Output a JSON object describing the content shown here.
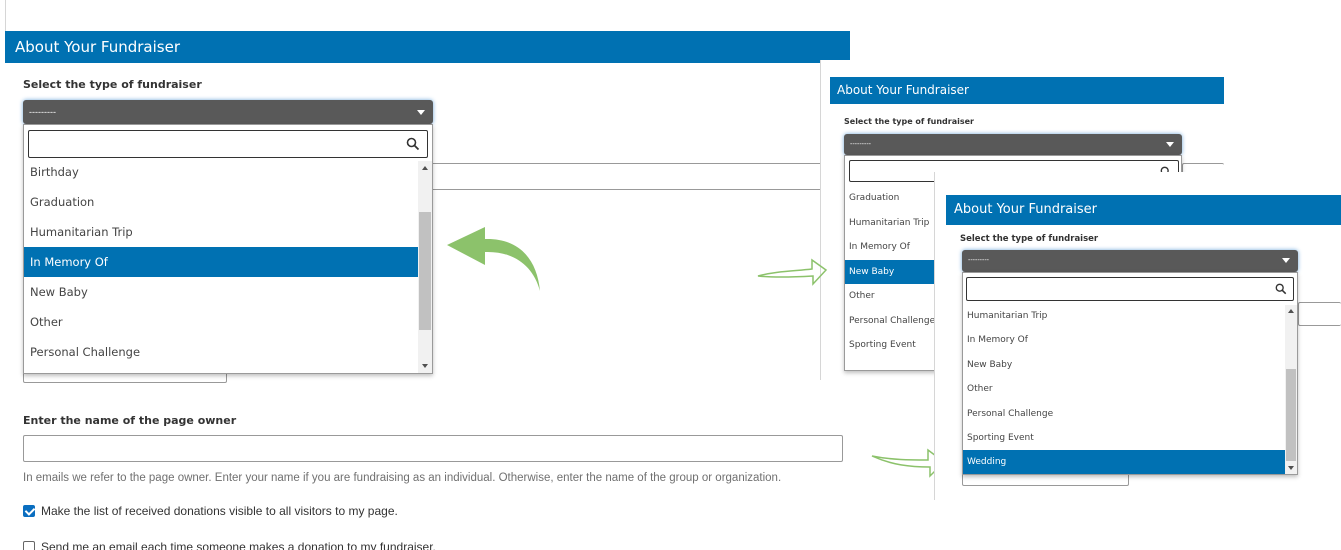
{
  "panels": {
    "main": {
      "header": "About Your Fundraiser",
      "type_label": "Select the type of fundraiser",
      "select_value": "---------",
      "search_value": "",
      "options": [
        {
          "label": "Birthday",
          "selected": false
        },
        {
          "label": "Graduation",
          "selected": false
        },
        {
          "label": "Humanitarian Trip",
          "selected": false
        },
        {
          "label": "In Memory Of",
          "selected": true
        },
        {
          "label": "New Baby",
          "selected": false
        },
        {
          "label": "Other",
          "selected": false
        },
        {
          "label": "Personal Challenge",
          "selected": false
        }
      ]
    },
    "second": {
      "header": "About Your Fundraiser",
      "type_label": "Select the type of fundraiser",
      "select_value": "---------",
      "search_value": "",
      "options": [
        {
          "label": "Graduation",
          "selected": false
        },
        {
          "label": "Humanitarian Trip",
          "selected": false
        },
        {
          "label": "In Memory Of",
          "selected": false
        },
        {
          "label": "New Baby",
          "selected": true
        },
        {
          "label": "Other",
          "selected": false
        },
        {
          "label": "Personal Challenge",
          "selected": false
        },
        {
          "label": "Sporting Event",
          "selected": false
        }
      ]
    },
    "third": {
      "header": "About Your Fundraiser",
      "type_label": "Select the type of fundraiser",
      "select_value": "---------",
      "search_value": "",
      "options": [
        {
          "label": "Humanitarian Trip",
          "selected": false
        },
        {
          "label": "In Memory Of",
          "selected": false
        },
        {
          "label": "New Baby",
          "selected": false
        },
        {
          "label": "Other",
          "selected": false
        },
        {
          "label": "Personal Challenge",
          "selected": false
        },
        {
          "label": "Sporting Event",
          "selected": false
        },
        {
          "label": "Wedding",
          "selected": true
        }
      ]
    }
  },
  "owner": {
    "label": "Enter the name of the page owner",
    "value": "",
    "help": "In emails we refer to the page owner. Enter your name if you are fundraising as an individual. Otherwise, enter the name of the group or organization."
  },
  "checkboxes": [
    {
      "label": "Make the list of received donations visible to all visitors to my page.",
      "checked": true
    },
    {
      "label": "Send me an email each time someone makes a donation to my fundraiser.",
      "checked": false
    }
  ],
  "icons": {
    "search": "search-icon",
    "caret": "chevron-down-icon",
    "arrow": "curved-arrow-icon"
  },
  "colors": {
    "header_bg": "#0071b2",
    "select_bg": "#595959",
    "selected_option_bg": "#0071b2",
    "arrow_green": "#8cc26b",
    "checkbox_checked": "#0a6ec0"
  }
}
